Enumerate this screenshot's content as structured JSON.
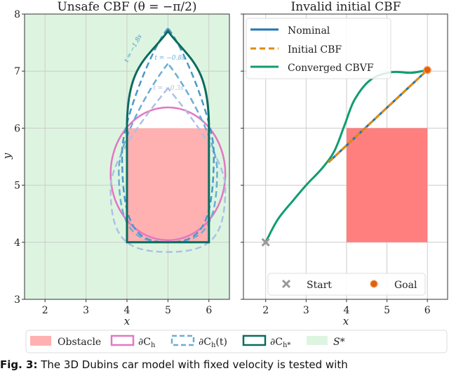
{
  "chart_data": [
    {
      "type": "line",
      "title": "Unsafe CBF (θ = −π/2)",
      "xlabel": "x",
      "ylabel": "y",
      "xlim": [
        1.5,
        6.5
      ],
      "ylim": [
        3,
        8
      ],
      "xticks": [
        "2",
        "3",
        "4",
        "5",
        "6"
      ],
      "yticks": [
        "3",
        "4",
        "5",
        "6",
        "7",
        "8"
      ],
      "grid": true,
      "background_region": {
        "name": "S*",
        "color": "#ddf5e0"
      },
      "obstacle": {
        "x": [
          4,
          6
        ],
        "y": [
          4,
          6
        ],
        "color": "#ffb0b0"
      },
      "series": [
        {
          "name": "∂C_h",
          "shape": "ellipse",
          "center": [
            5,
            5.2
          ],
          "radii": [
            1.4,
            1.2
          ],
          "color": "#e377c2",
          "style": "solid"
        },
        {
          "name": "∂C_h(t) t=−0.3s",
          "label": "t = −0.3s",
          "apex": [
            5,
            6.7
          ],
          "bottom": 3.83,
          "halfwidth": 1.4,
          "color": "#aec0e4",
          "style": "dashed"
        },
        {
          "name": "∂C_h(t) t=−0.8s",
          "label": "t = −0.8s",
          "apex": [
            5,
            7.13
          ],
          "bottom": 4.0,
          "halfwidth": 1.2,
          "color": "#6aaed6",
          "style": "dashed"
        },
        {
          "name": "∂C_h(t) t=−1.8s",
          "label": "t = −1.8s",
          "apex": [
            5,
            7.75
          ],
          "bottom": 4.0,
          "halfwidth": 1.12,
          "color": "#4a98c9",
          "style": "dashed"
        },
        {
          "name": "∂C_h*",
          "apex": [
            5,
            7.7
          ],
          "bottom": 4.0,
          "halfwidth": 1.0,
          "color": "#0b6b5e",
          "style": "solid"
        }
      ]
    },
    {
      "type": "line",
      "title": "Invalid initial CBF",
      "xlabel": "x",
      "ylabel": "",
      "xlim": [
        1.45,
        6.5
      ],
      "ylim": [
        3,
        8
      ],
      "xticks": [
        "2",
        "3",
        "4",
        "5",
        "6"
      ],
      "grid": true,
      "obstacle": {
        "x": [
          4,
          6
        ],
        "y": [
          4,
          6
        ],
        "color": "#ff7f7f"
      },
      "series": [
        {
          "name": "Nominal",
          "color": "#1f77b4",
          "style": "solid",
          "points": [
            [
              3.55,
              5.4
            ],
            [
              6,
              7.02
            ]
          ]
        },
        {
          "name": "Initial CBF",
          "color": "#e08a12",
          "style": "dashed",
          "points": [
            [
              3.55,
              5.4
            ],
            [
              6,
              7.02
            ]
          ]
        },
        {
          "name": "Converged CBVF",
          "color": "#119c71",
          "style": "solid",
          "points": [
            [
              2.0,
              4.0
            ],
            [
              2.3,
              4.4
            ],
            [
              2.7,
              4.75
            ],
            [
              3.0,
              5.0
            ],
            [
              3.4,
              5.3
            ],
            [
              3.7,
              5.6
            ],
            [
              3.95,
              6.05
            ],
            [
              4.2,
              6.5
            ],
            [
              4.6,
              6.85
            ],
            [
              5.1,
              6.98
            ],
            [
              5.6,
              6.97
            ],
            [
              6.0,
              7.02
            ]
          ]
        }
      ],
      "markers": [
        {
          "name": "Start",
          "x": 2,
          "y": 4,
          "symbol": "x",
          "color": "#999999"
        },
        {
          "name": "Goal",
          "x": 6,
          "y": 7.02,
          "symbol": "o",
          "color": "#e06010"
        }
      ]
    }
  ],
  "legend_right_top": [
    "Nominal",
    "Initial CBF",
    "Converged CBVF"
  ],
  "legend_right_bottom": [
    "Start",
    "Goal"
  ],
  "legend_bottom": [
    {
      "label": "Obstacle",
      "color": "#ffb0b0",
      "kind": "fill"
    },
    {
      "label": "∂C",
      "sub": "h",
      "color": "#e377c2",
      "kind": "outline"
    },
    {
      "label": "∂C",
      "sub": "h",
      "suffix": "(t)",
      "color": "#6aaed6",
      "kind": "dashed"
    },
    {
      "label": "∂C",
      "sub": "h*",
      "color": "#0b6b5e",
      "kind": "outline"
    },
    {
      "label": "S*",
      "color": "#ddf5e0",
      "kind": "fill"
    }
  ],
  "caption": "Fig. 3: The 3D Dubins car model with fixed velocity is tested with"
}
